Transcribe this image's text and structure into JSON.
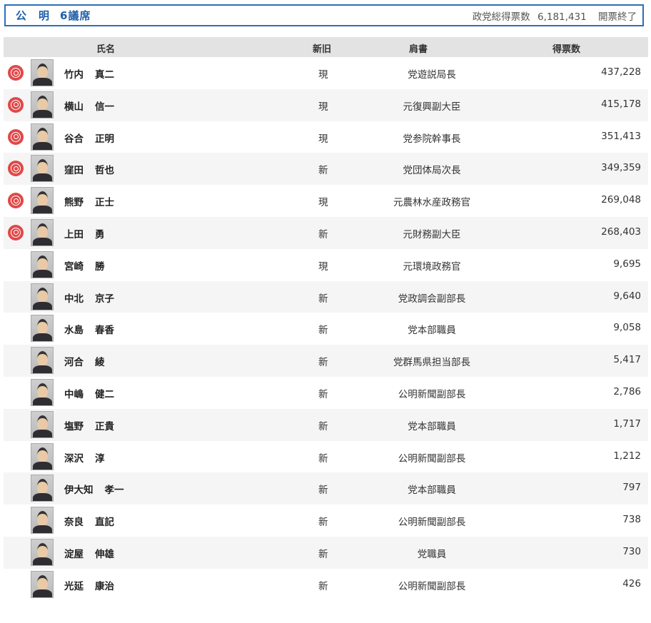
{
  "party": {
    "name": "公　明",
    "seats": "6議席",
    "total_label": "政党総得票数",
    "total_votes": "6,181,431",
    "state": "開票終了"
  },
  "columns": {
    "name": "氏名",
    "status": "新旧",
    "title": "肩書",
    "votes": "得票数"
  },
  "colors": {
    "accent": "#2a6fb8",
    "elected_mark": "#e04848"
  },
  "candidates": [
    {
      "family": "竹内",
      "given": "真二",
      "status": "現",
      "title": "党遊説局長",
      "votes": "437,228",
      "elected": true
    },
    {
      "family": "横山",
      "given": "信一",
      "status": "現",
      "title": "元復興副大臣",
      "votes": "415,178",
      "elected": true
    },
    {
      "family": "谷合",
      "given": "正明",
      "status": "現",
      "title": "党参院幹事長",
      "votes": "351,413",
      "elected": true
    },
    {
      "family": "窪田",
      "given": "哲也",
      "status": "新",
      "title": "党団体局次長",
      "votes": "349,359",
      "elected": true
    },
    {
      "family": "熊野",
      "given": "正士",
      "status": "現",
      "title": "元農林水産政務官",
      "votes": "269,048",
      "elected": true
    },
    {
      "family": "上田",
      "given": "勇",
      "status": "新",
      "title": "元財務副大臣",
      "votes": "268,403",
      "elected": true
    },
    {
      "family": "宮崎",
      "given": "勝",
      "status": "現",
      "title": "元環境政務官",
      "votes": "9,695",
      "elected": false
    },
    {
      "family": "中北",
      "given": "京子",
      "status": "新",
      "title": "党政調会副部長",
      "votes": "9,640",
      "elected": false
    },
    {
      "family": "水島",
      "given": "春香",
      "status": "新",
      "title": "党本部職員",
      "votes": "9,058",
      "elected": false
    },
    {
      "family": "河合",
      "given": "綾",
      "status": "新",
      "title": "党群馬県担当部長",
      "votes": "5,417",
      "elected": false
    },
    {
      "family": "中嶋",
      "given": "健二",
      "status": "新",
      "title": "公明新聞副部長",
      "votes": "2,786",
      "elected": false
    },
    {
      "family": "塩野",
      "given": "正貴",
      "status": "新",
      "title": "党本部職員",
      "votes": "1,717",
      "elected": false
    },
    {
      "family": "深沢",
      "given": "淳",
      "status": "新",
      "title": "公明新聞副部長",
      "votes": "1,212",
      "elected": false
    },
    {
      "family": "伊大知",
      "given": "孝一",
      "status": "新",
      "title": "党本部職員",
      "votes": "797",
      "elected": false
    },
    {
      "family": "奈良",
      "given": "直記",
      "status": "新",
      "title": "公明新聞副部長",
      "votes": "738",
      "elected": false
    },
    {
      "family": "淀屋",
      "given": "伸雄",
      "status": "新",
      "title": "党職員",
      "votes": "730",
      "elected": false
    },
    {
      "family": "光延",
      "given": "康治",
      "status": "新",
      "title": "公明新聞副部長",
      "votes": "426",
      "elected": false
    }
  ]
}
